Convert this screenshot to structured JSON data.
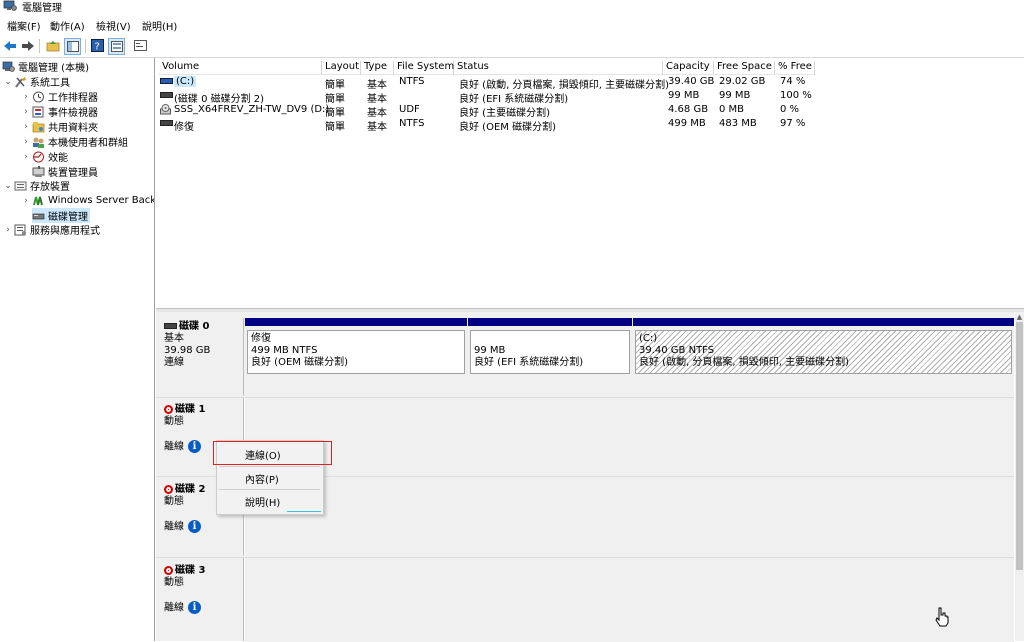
{
  "window": {
    "title": "電腦管理"
  },
  "menu": [
    "檔案(F)",
    "動作(A)",
    "檢視(V)",
    "說明(H)"
  ],
  "tree": [
    {
      "label": "電腦管理 (本機)",
      "icon": "computer-management-icon"
    },
    {
      "label": "系統工具",
      "icon": "system-tools-icon"
    },
    {
      "label": "工作排程器",
      "icon": "clock-icon"
    },
    {
      "label": "事件檢視器",
      "icon": "event-viewer-icon"
    },
    {
      "label": "共用資料夾",
      "icon": "shared-folder-icon"
    },
    {
      "label": "本機使用者和群組",
      "icon": "users-icon"
    },
    {
      "label": "效能",
      "icon": "performance-icon"
    },
    {
      "label": "裝置管理員",
      "icon": "device-manager-icon"
    },
    {
      "label": "存放裝置",
      "icon": "storage-icon"
    },
    {
      "label": "Windows Server Backu",
      "icon": "backup-icon"
    },
    {
      "label": "磁碟管理",
      "icon": "disk-management-icon"
    },
    {
      "label": "服務與應用程式",
      "icon": "services-icon"
    }
  ],
  "volumes": {
    "headers": [
      "Volume",
      "Layout",
      "Type",
      "File System",
      "Status",
      "Capacity",
      "Free Space",
      "% Free"
    ],
    "rows": [
      [
        "(C:)",
        "簡單",
        "基本",
        "NTFS",
        "良好 (啟動, 分頁檔案, 損毀傾印, 主要磁碟分割)",
        "39.40 GB",
        "29.02 GB",
        "74 %"
      ],
      [
        "(磁碟 0 磁碟分割 2)",
        "簡單",
        "基本",
        "",
        "良好 (EFI 系統磁碟分割)",
        "99 MB",
        "99 MB",
        "100 %"
      ],
      [
        "SSS_X64FREV_ZH-TW_DV9 (D:)",
        "簡單",
        "基本",
        "UDF",
        "良好 (主要磁碟分割)",
        "4.68 GB",
        "0 MB",
        "0 %"
      ],
      [
        "修復",
        "簡單",
        "基本",
        "NTFS",
        "良好 (OEM 磁碟分割)",
        "499 MB",
        "483 MB",
        "97 %"
      ]
    ]
  },
  "disks": {
    "disk0": {
      "name": "磁碟 0",
      "type": "基本",
      "size": "39.98 GB",
      "status": "連線",
      "partitions": [
        {
          "name": "修復",
          "fs": "499 MB NTFS",
          "status": "良好 (OEM 磁碟分割)"
        },
        {
          "name": "",
          "fs": "99 MB",
          "status": "良好 (EFI 系統磁碟分割)"
        },
        {
          "name": "(C:)",
          "fs": "39.40 GB NTFS",
          "status": "良好 (啟動, 分頁檔案, 損毀傾印, 主要磁碟分割)"
        }
      ]
    },
    "disk1": {
      "name": "磁碟 1",
      "type": "動態",
      "status": "離線"
    },
    "disk2": {
      "name": "磁碟 2",
      "type": "動態",
      "status": "離線"
    },
    "disk3": {
      "name": "磁碟 3",
      "type": "動態",
      "status": "離線"
    }
  },
  "context_menu": {
    "items": [
      "連線(O)",
      "內容(P)",
      "說明(H)"
    ],
    "highlight_color": "#e02020"
  },
  "colors": {
    "partition_bar": "#000080",
    "selection": "#cce8ff"
  }
}
